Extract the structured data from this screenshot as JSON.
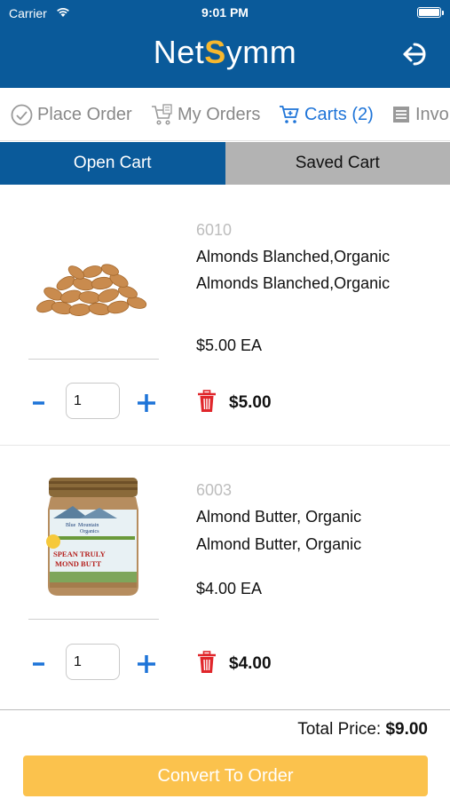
{
  "status_bar": {
    "carrier": "Carrier",
    "time": "9:01 PM"
  },
  "header": {
    "logo_prefix": "Net",
    "logo_mark": "S",
    "logo_suffix": "ymm",
    "logout_icon": "logout-icon"
  },
  "nav": {
    "items": [
      {
        "label": "Place Order",
        "icon": "check-circle-icon"
      },
      {
        "label": "My Orders",
        "icon": "cart-list-icon"
      },
      {
        "label": "Carts (2)",
        "icon": "cart-icon",
        "active": true
      },
      {
        "label": "Invo",
        "icon": "invoice-icon"
      }
    ]
  },
  "segments": {
    "open": "Open Cart",
    "saved": "Saved Cart"
  },
  "items": [
    {
      "sku": "6010",
      "name": "Almonds Blanched,Organic",
      "description": "Almonds Blanched,Organic",
      "price": "$5.00 EA",
      "quantity": "1",
      "line_total": "$5.00",
      "image": "almonds-image"
    },
    {
      "sku": "6003",
      "name": "Almond Butter, Organic",
      "description": "Almond Butter, Organic",
      "price": "$4.00 EA",
      "quantity": "1",
      "line_total": "$4.00",
      "image": "almond-butter-jar-image",
      "jar_label": {
        "brand1": "Blue",
        "brand2": "Mountain",
        "brand3": "Organics",
        "line1": "SPEAN TRULY",
        "line2": "MOND BUTT"
      }
    }
  ],
  "footer": {
    "total_label": "Total Price:",
    "total_value": "$9.00",
    "convert_label": "Convert To Order"
  },
  "colors": {
    "header": "#0a5a9a",
    "accent": "#1e74d8",
    "convert": "#fbc24d",
    "trash": "#e0262b"
  }
}
